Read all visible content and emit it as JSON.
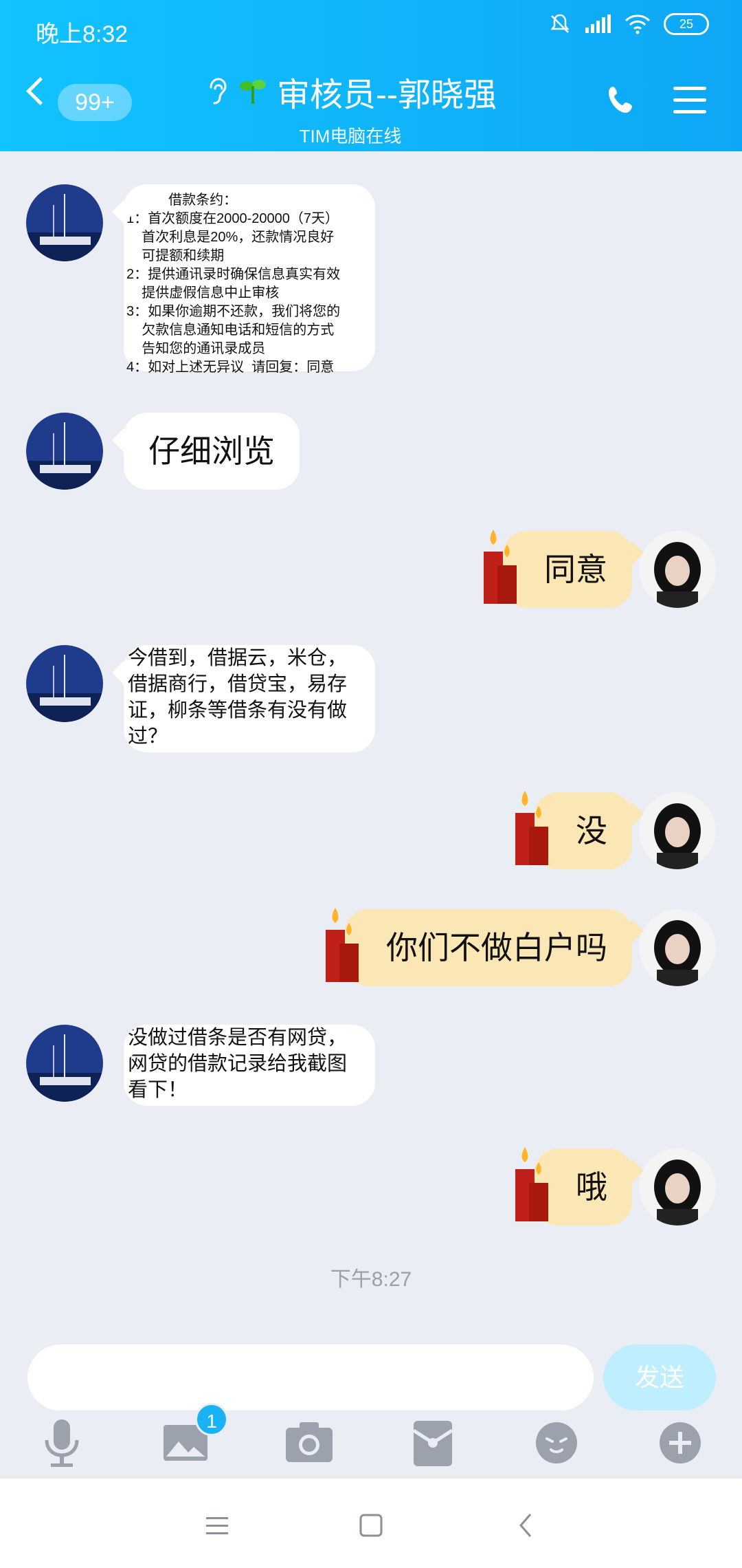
{
  "status_bar": {
    "time": "晚上8:32",
    "battery": "25"
  },
  "header": {
    "unread_count": "99+",
    "title": "审核员--郭晓强",
    "subtitle": "TIM电脑在线"
  },
  "messages": [
    {
      "side": "left",
      "type": "contract",
      "lines": [
        "           借款条约：",
        "1：首次额度在2000-20000（7天）",
        "    首次利息是20%，还款情况良好",
        "    可提额和续期",
        "2：提供通讯录时确保信息真实有效",
        "    提供虚假信息中止审核",
        "3：如果你逾期不还款，我们将您的",
        "    欠款信息通知电话和短信的方式",
        "    告知您的通讯录成员",
        "4：如对上述无异议  请回复：同意"
      ]
    },
    {
      "side": "left",
      "text": "仔细浏览"
    },
    {
      "side": "right",
      "text": "同意"
    },
    {
      "side": "left",
      "text": "今借到，借据云，米仓，\n借据商行，借贷宝，易存\n证，柳条等借条有没有做\n过？"
    },
    {
      "side": "right",
      "text": "没"
    },
    {
      "side": "right",
      "text": "你们不做白户吗"
    },
    {
      "side": "left",
      "text": "没做过借条是否有网贷，\n网贷的借款记录给我截图\n看下！"
    },
    {
      "side": "right",
      "text": "哦"
    }
  ],
  "timestamp": "下午8:27",
  "input": {
    "value": "",
    "send_label": "发送"
  },
  "toolbar": {
    "image_badge": "1"
  },
  "icons": {
    "back": "chevron-left-icon",
    "ear": "ear-icon",
    "sprout": "sprout-icon",
    "phone": "phone-icon",
    "menu": "hamburger-menu-icon"
  },
  "colors": {
    "header": "#11c3ff",
    "background": "#ebedf5",
    "self_bubble": "#fbe7b6",
    "send_button": "#bfeeff",
    "badge": "#18b2f5"
  }
}
